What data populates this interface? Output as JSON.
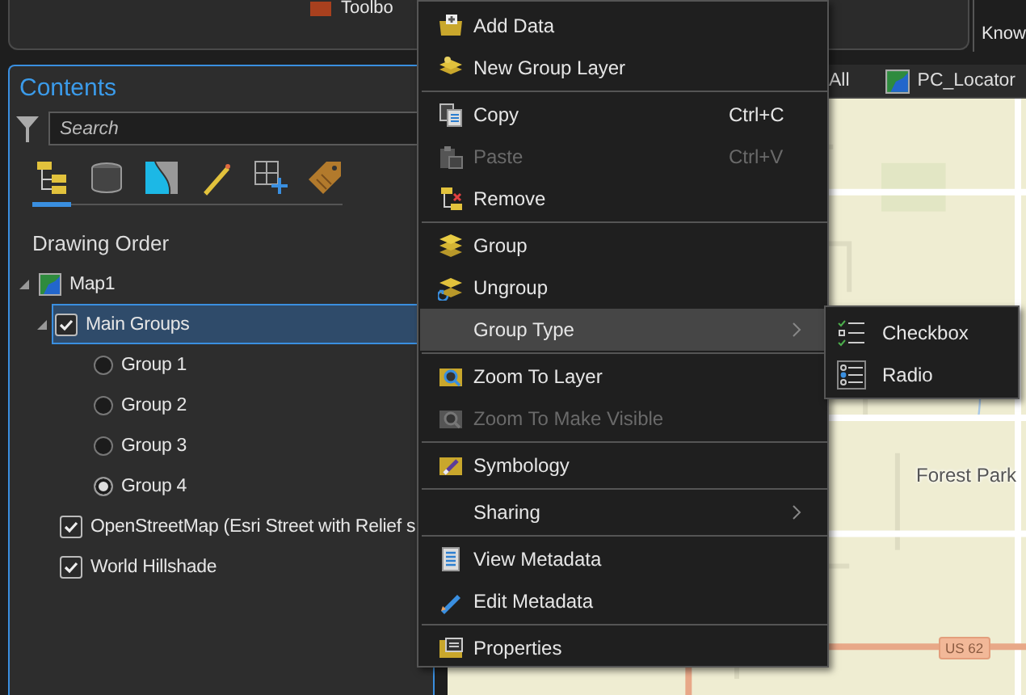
{
  "ribbon": {
    "toolbox_label": "Toolbo",
    "right_label": "Know"
  },
  "contents": {
    "title": "Contents",
    "search": {
      "placeholder": "Search"
    },
    "view_tabs": [
      {
        "selected": true
      },
      {
        "selected": false
      },
      {
        "selected": false
      },
      {
        "selected": false
      },
      {
        "selected": false
      },
      {
        "selected": false
      }
    ],
    "heading": "Drawing Order",
    "tree": [
      {
        "kind": "map",
        "label": "Map1",
        "expanded": true,
        "selected": false,
        "children": [
          {
            "kind": "checkbox",
            "label": "Main Groups",
            "checked": true,
            "expanded": true,
            "selected": true,
            "children": [
              {
                "kind": "radio",
                "label": "Group 1",
                "checked": false,
                "selected": false
              },
              {
                "kind": "radio",
                "label": "Group 2",
                "checked": false,
                "selected": false
              },
              {
                "kind": "radio",
                "label": "Group 3",
                "checked": false,
                "selected": false
              },
              {
                "kind": "radio",
                "label": "Group 4",
                "checked": true,
                "selected": false
              }
            ]
          },
          {
            "kind": "checkbox",
            "label": "OpenStreetMap (Esri Street with Relief s",
            "checked": true,
            "selected": false
          },
          {
            "kind": "checkbox",
            "label": "World Hillshade",
            "checked": true,
            "selected": false
          }
        ]
      }
    ]
  },
  "map_tabs": [
    {
      "label": "All"
    },
    {
      "label": "PC_Locator"
    }
  ],
  "map": {
    "labels": [
      "Forest Park"
    ],
    "route_shield": "US 62"
  },
  "context_menu": {
    "items": [
      {
        "kind": "item",
        "label": "Add Data",
        "disabled": false,
        "selected": false
      },
      {
        "kind": "item",
        "label": "New Group Layer",
        "disabled": false,
        "selected": false
      },
      {
        "kind": "separator"
      },
      {
        "kind": "item",
        "label": "Copy",
        "shortcut": "Ctrl+C",
        "disabled": false,
        "selected": false
      },
      {
        "kind": "item",
        "label": "Paste",
        "shortcut": "Ctrl+V",
        "disabled": true,
        "selected": false
      },
      {
        "kind": "item",
        "label": "Remove",
        "disabled": false,
        "selected": false
      },
      {
        "kind": "separator"
      },
      {
        "kind": "item",
        "label": "Group",
        "disabled": false,
        "selected": false
      },
      {
        "kind": "item",
        "label": "Ungroup",
        "disabled": false,
        "selected": false
      },
      {
        "kind": "item",
        "label": "Group Type",
        "disabled": false,
        "selected": true,
        "submenu": true
      },
      {
        "kind": "separator"
      },
      {
        "kind": "item",
        "label": "Zoom To Layer",
        "disabled": false,
        "selected": false
      },
      {
        "kind": "item",
        "label": "Zoom To Make Visible",
        "disabled": true,
        "selected": false
      },
      {
        "kind": "separator"
      },
      {
        "kind": "item",
        "label": "Symbology",
        "disabled": false,
        "selected": false
      },
      {
        "kind": "separator"
      },
      {
        "kind": "item",
        "label": "Sharing",
        "disabled": false,
        "selected": false,
        "submenu": true
      },
      {
        "kind": "separator"
      },
      {
        "kind": "item",
        "label": "View Metadata",
        "disabled": false,
        "selected": false
      },
      {
        "kind": "item",
        "label": "Edit Metadata",
        "disabled": false,
        "selected": false
      },
      {
        "kind": "separator"
      },
      {
        "kind": "item",
        "label": "Properties",
        "disabled": false,
        "selected": false
      }
    ]
  },
  "submenu": {
    "items": [
      {
        "label": "Checkbox",
        "selected": false
      },
      {
        "label": "Radio",
        "selected": false
      }
    ]
  }
}
